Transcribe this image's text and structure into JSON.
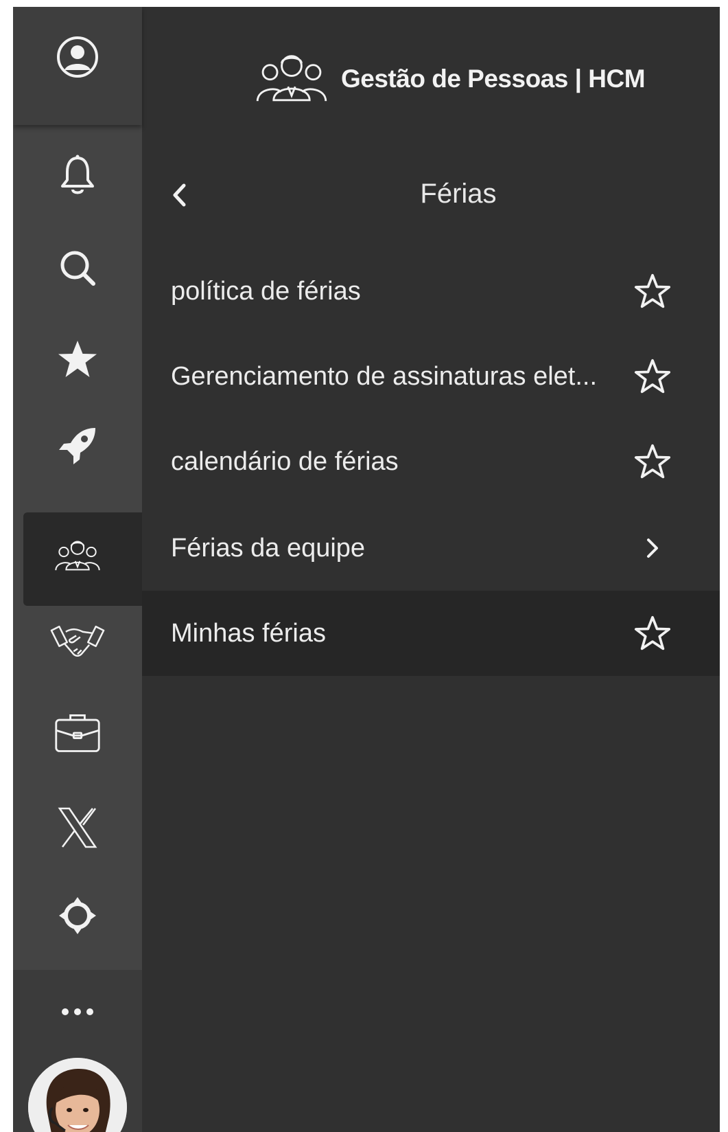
{
  "app": {
    "title": "Gestão de Pessoas | HCM",
    "logo_icon": "people-group-icon"
  },
  "rail": {
    "items": [
      {
        "icon": "user-circle-icon"
      },
      {
        "icon": "bell-icon"
      },
      {
        "icon": "search-icon"
      },
      {
        "icon": "star-icon"
      },
      {
        "icon": "rocket-icon"
      },
      {
        "icon": "people-group-icon",
        "active": true
      },
      {
        "icon": "handshake-icon"
      },
      {
        "icon": "briefcase-icon"
      },
      {
        "icon": "x-logo-icon"
      },
      {
        "icon": "crosshair-icon"
      },
      {
        "icon": "more-dots-icon"
      }
    ]
  },
  "nav": {
    "back_icon": "chevron-left-icon",
    "title": "Férias"
  },
  "menu": {
    "items": [
      {
        "label": "política de férias",
        "action_icon": "star-outline-icon"
      },
      {
        "label": "Gerenciamento de assinaturas elet...",
        "action_icon": "star-outline-icon"
      },
      {
        "label": "calendário de férias",
        "action_icon": "star-outline-icon"
      },
      {
        "label": "Férias da equipe",
        "action_icon": "chevron-right-icon"
      },
      {
        "label": "Minhas férias",
        "action_icon": "star-outline-icon",
        "highlighted": true
      }
    ]
  },
  "colors": {
    "rail_bg": "#444444",
    "panel_bg": "#303030",
    "highlight_bg": "#262626",
    "text": "#ececec"
  }
}
